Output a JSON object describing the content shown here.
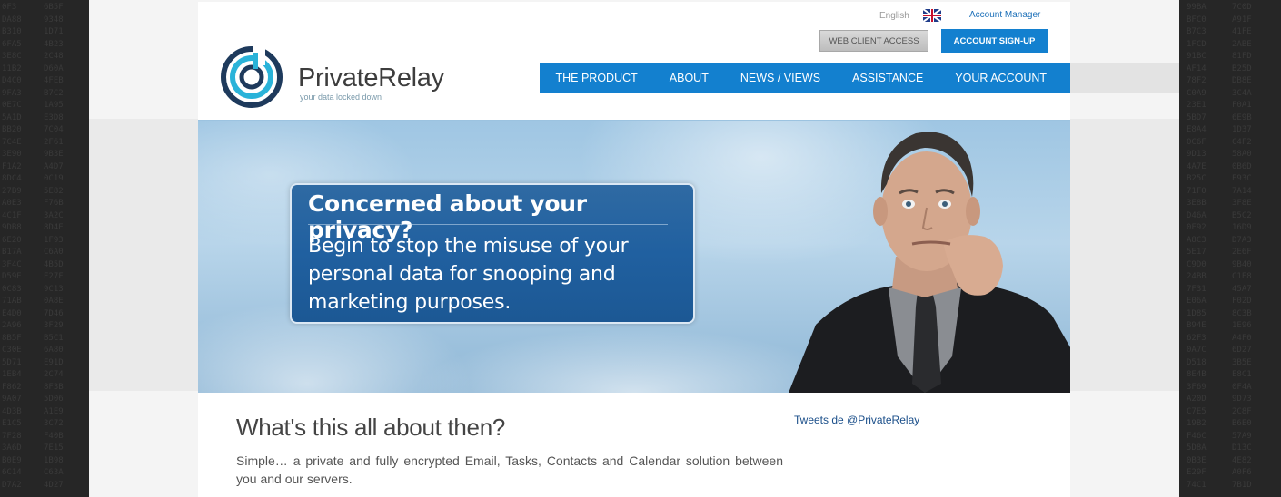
{
  "header": {
    "language": "English",
    "language_flag_icon": "uk-flag-icon",
    "account_manager": "Account Manager",
    "web_client_access": "WEB CLIENT ACCESS",
    "account_signup": "ACCOUNT SIGN-UP"
  },
  "brand": {
    "name_part1": "Private",
    "name_part2": "Relay",
    "tagline": "your data locked down",
    "logo_icon": "private-relay-logo-icon"
  },
  "nav": {
    "items": [
      {
        "label": "THE PRODUCT"
      },
      {
        "label": "ABOUT"
      },
      {
        "label": "NEWS / VIEWS"
      },
      {
        "label": "ASSISTANCE"
      },
      {
        "label": "YOUR ACCOUNT"
      }
    ]
  },
  "hero": {
    "heading": "Concerned about your privacy?",
    "body": "Begin to stop the misuse of your personal data for snooping and marketing purposes."
  },
  "content": {
    "title": "What's this all about then?",
    "text": "Simple… a private and fully encrypted Email, Tasks, Contacts and Calendar solution between you and our servers.",
    "tweets_link": "Tweets de @PrivateRelay"
  },
  "colors": {
    "accent": "#1380cf",
    "link": "#1b6fb8",
    "brand_teal": "#2ab3d9",
    "brand_navy": "#1e3a5c"
  }
}
